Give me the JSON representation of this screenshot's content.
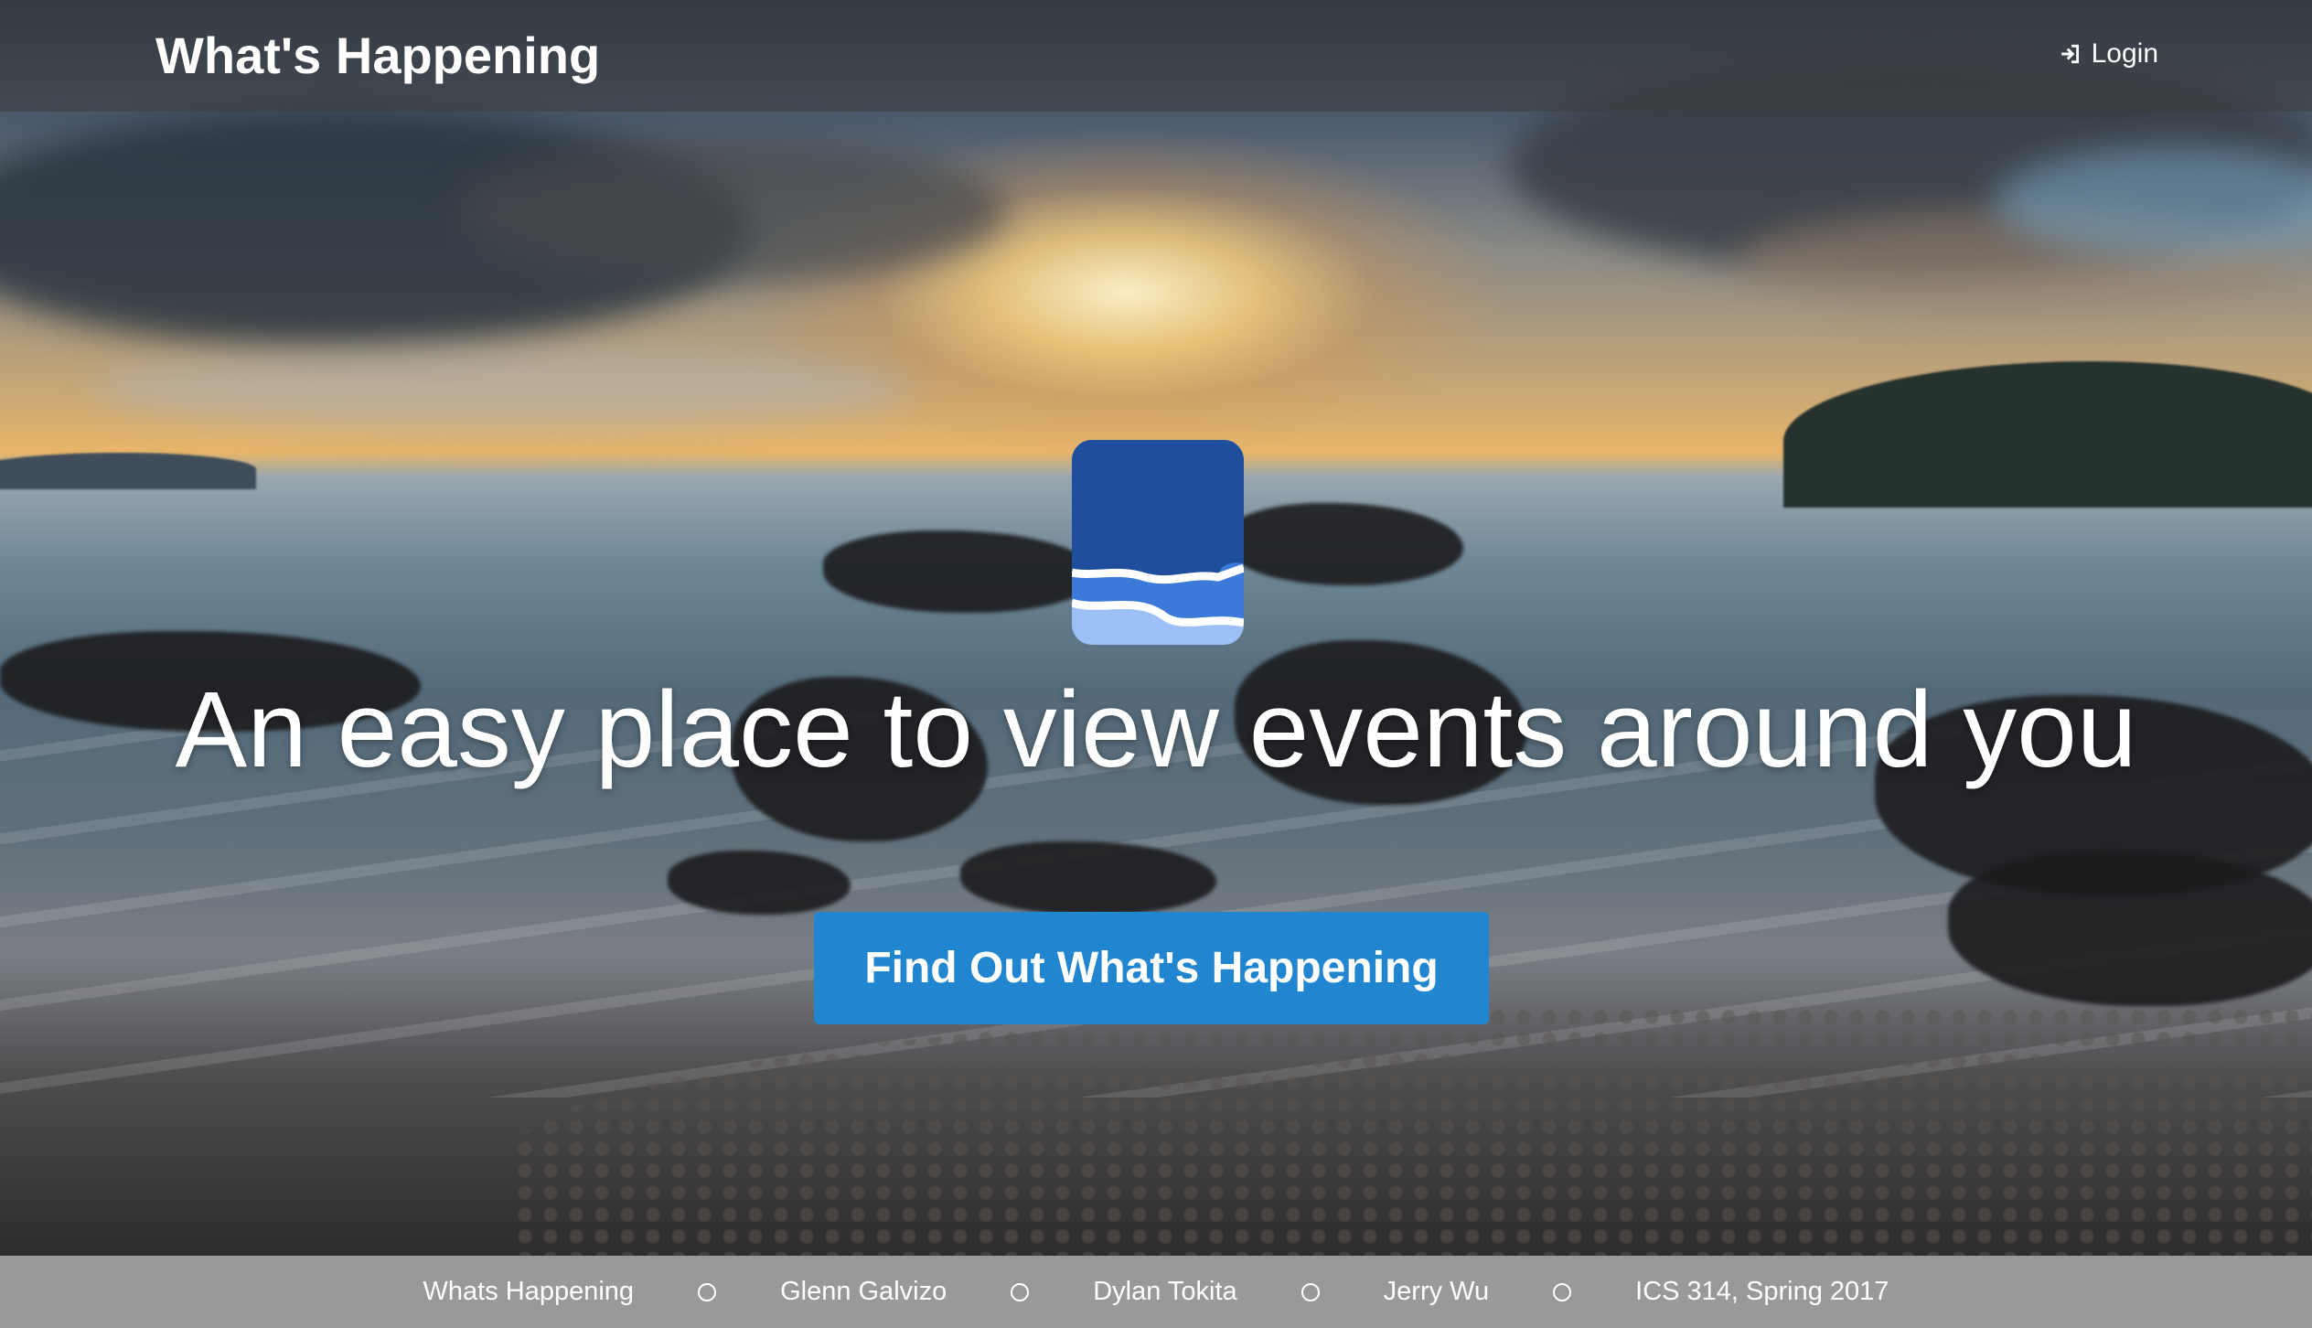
{
  "navbar": {
    "brand": "What's Happening",
    "login_label": "Login",
    "login_icon": "sign-in-icon"
  },
  "hero": {
    "logo_icon": "chat-bubble-logo-icon",
    "headline": "An easy place to view events around you",
    "cta_label": "Find Out What's Happening"
  },
  "footer": {
    "items": [
      "Whats Happening",
      "Glenn Galvizo",
      "Dylan Tokita",
      "Jerry Wu",
      "ICS 314, Spring 2017"
    ],
    "separator_icon": "circle-outline-icon"
  },
  "colors": {
    "cta_bg": "#2185d0",
    "footer_bg": "#999999",
    "logo_dark": "#1f4e9c",
    "logo_mid": "#3b7ad9",
    "logo_light": "#9cc0f5"
  }
}
